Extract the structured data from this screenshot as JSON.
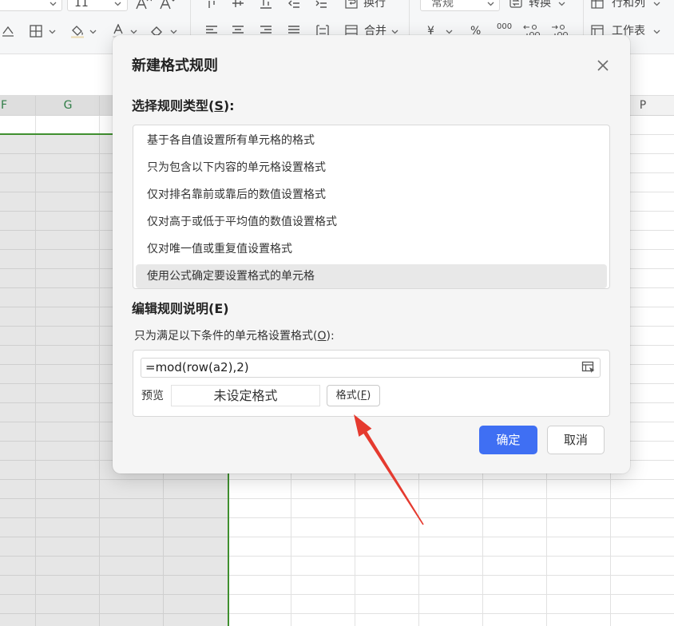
{
  "ribbon": {
    "font_size": "11",
    "wrap_text": "换行",
    "number_format": "常规",
    "convert": "转换",
    "rows_and_columns": "行和列",
    "merge": "合并",
    "currency": "¥",
    "percent": "%",
    "thousands": "000",
    "worksheet": "工作表"
  },
  "sheet": {
    "column_headers": [
      {
        "label": "F",
        "selected": true
      },
      {
        "label": "G",
        "selected": true
      },
      {
        "label": "P",
        "selected": false
      }
    ]
  },
  "dialog": {
    "title": "新建格式规则",
    "rule_type_label": {
      "before": "选择规则类型(",
      "key": "S",
      "after": "):"
    },
    "rule_types": [
      "基于各自值设置所有单元格的格式",
      "只为包含以下内容的单元格设置格式",
      "仅对排名靠前或靠后的数值设置格式",
      "仅对高于或低于平均值的数值设置格式",
      "仅对唯一值或重复值设置格式",
      "使用公式确定要设置格式的单元格"
    ],
    "selected_rule_index": 5,
    "edit_label": "编辑规则说明(E)",
    "condition_label": {
      "before": "只为满足以下条件的单元格设置格式(",
      "key": "O",
      "after": "):"
    },
    "formula": "=mod(row(a2),2)",
    "preview_label": "预览",
    "preview_text": "未设定格式",
    "format_button": {
      "before": "格式(",
      "key": "F",
      "after": ")"
    },
    "ok_button": "确定",
    "cancel_button": "取消"
  },
  "colors": {
    "accent": "#3f6ff3",
    "selection_border": "#3f8f2f",
    "selected_header_text": "#2f7d46",
    "annotation": "#e53a2f"
  }
}
